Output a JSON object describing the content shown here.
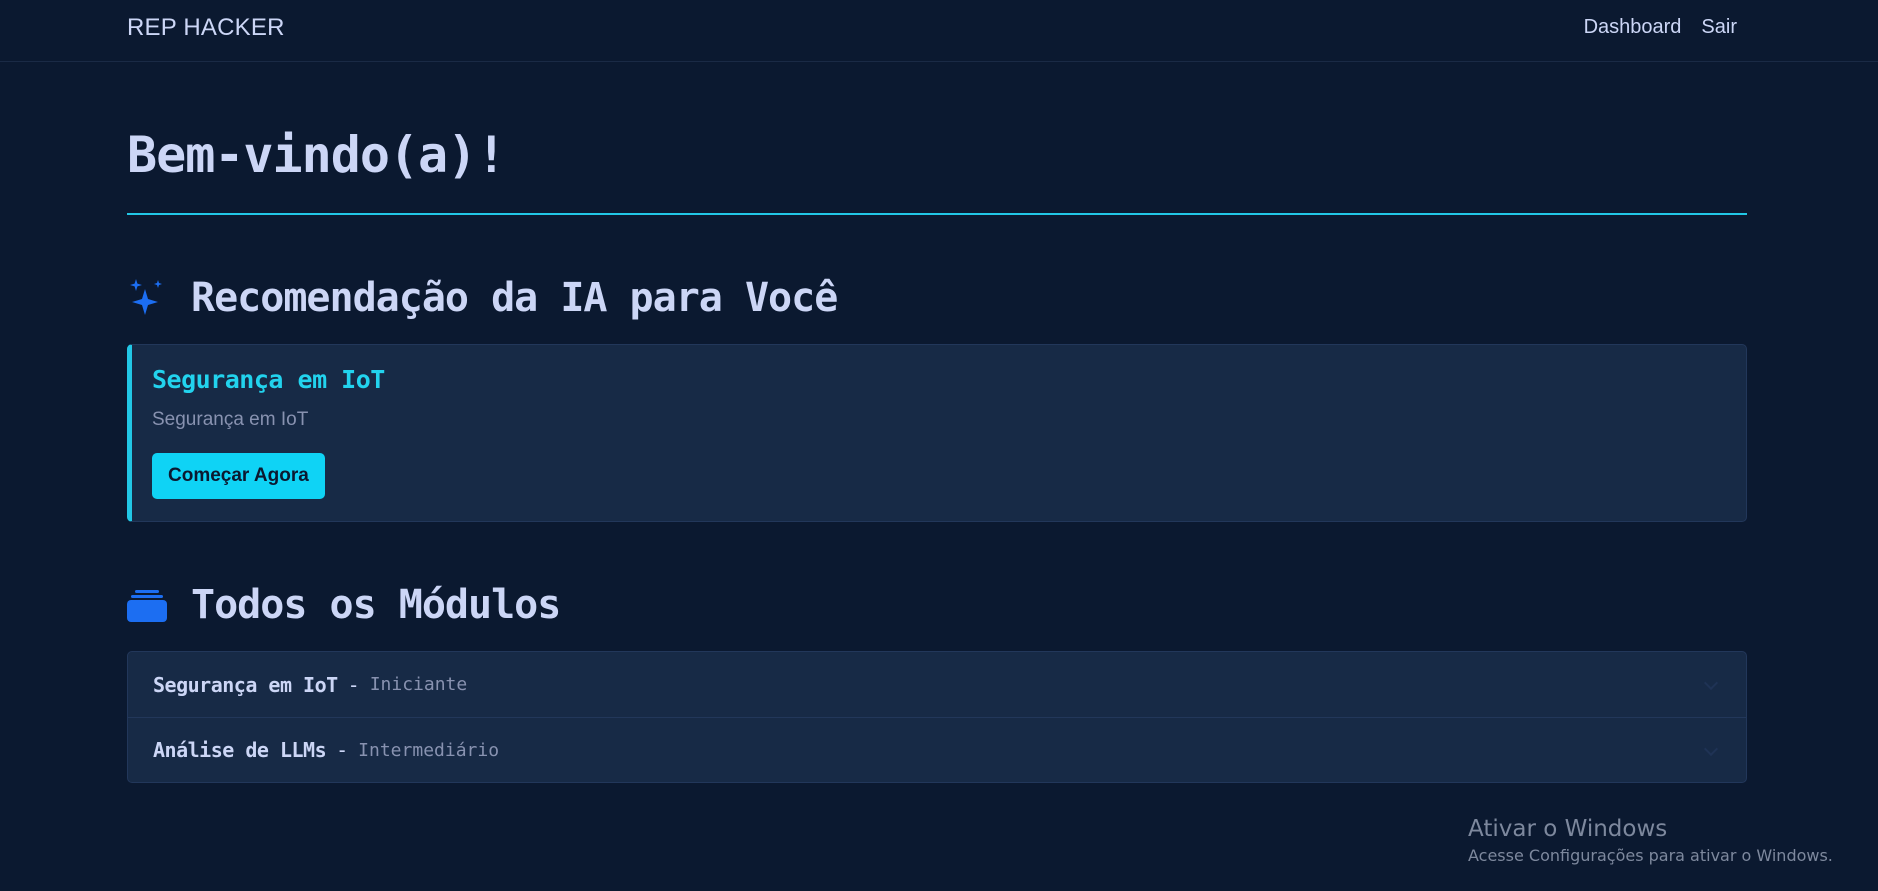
{
  "navbar": {
    "brand": "REP HACKER",
    "links": [
      {
        "label": "Dashboard"
      },
      {
        "label": "Sair"
      }
    ]
  },
  "page": {
    "title": "Bem-vindo(a)!"
  },
  "recommendation": {
    "heading": "Recomendação da IA para Você",
    "icon": "sparkles-icon",
    "card": {
      "title": "Segurança em IoT",
      "description": "Segurança em IoT",
      "button_label": "Começar Agora"
    }
  },
  "modules": {
    "heading": "Todos os Módulos",
    "icon": "stacked-folders-icon",
    "items": [
      {
        "name": "Segurança em IoT",
        "separator": "-",
        "level": "Iniciante"
      },
      {
        "name": "Análise de LLMs",
        "separator": "-",
        "level": "Intermediário"
      }
    ]
  },
  "watermark": {
    "title": "Ativar o Windows",
    "subtitle": "Acesse Configurações para ativar o Windows."
  },
  "colors": {
    "background": "#0b1930",
    "card": "#172a46",
    "accent": "#22c7e6",
    "button": "#0fd3f5",
    "icon_blue": "#1c6ef2",
    "text": "#ccd6f6",
    "muted": "#8892b0"
  }
}
